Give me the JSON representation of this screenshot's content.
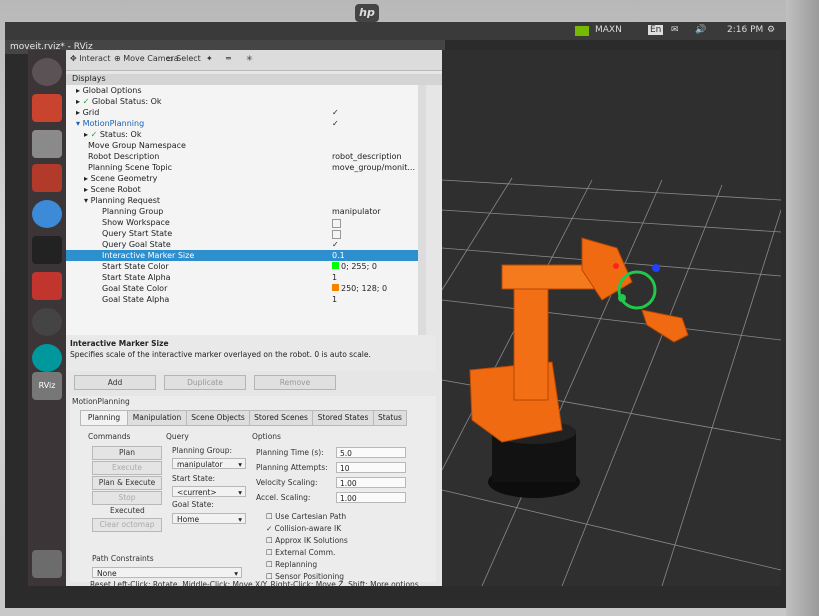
{
  "monitor": {
    "brand_logo": "hp"
  },
  "topbar": {
    "indicator": "MAXN",
    "keyboard": "En",
    "time": "2:16 PM"
  },
  "window": {
    "title": "moveit.rviz* - RViz"
  },
  "toolbar": {
    "interact": "Interact",
    "move_camera": "Move Camera",
    "select": "Select"
  },
  "displays": {
    "title": "Displays",
    "rows": [
      {
        "label": "Global Options",
        "value": ""
      },
      {
        "label": "Global Status: Ok",
        "value": ""
      },
      {
        "label": "Grid",
        "value": "✓"
      },
      {
        "label": "MotionPlanning",
        "value": "✓"
      },
      {
        "label": "Status: Ok",
        "value": ""
      },
      {
        "label": "Move Group Namespace",
        "value": ""
      },
      {
        "label": "Robot Description",
        "value": "robot_description"
      },
      {
        "label": "Planning Scene Topic",
        "value": "move_group/monit..."
      },
      {
        "label": "Scene Geometry",
        "value": ""
      },
      {
        "label": "Scene Robot",
        "value": ""
      },
      {
        "label": "Planning Request",
        "value": ""
      },
      {
        "label": "Planning Group",
        "value": "manipulator"
      },
      {
        "label": "Show Workspace",
        "value": ""
      },
      {
        "label": "Query Start State",
        "value": ""
      },
      {
        "label": "Query Goal State",
        "value": "✓"
      },
      {
        "label": "Interactive Marker Size",
        "value": "0.1"
      },
      {
        "label": "Start State Color",
        "value": "0; 255; 0"
      },
      {
        "label": "Start State Alpha",
        "value": "1"
      },
      {
        "label": "Goal State Color",
        "value": "250; 128; 0"
      },
      {
        "label": "Goal State Alpha",
        "value": "1"
      }
    ]
  },
  "description": {
    "title": "Interactive Marker Size",
    "text": "Specifies scale of the interactive marker overlayed on the robot. 0 is auto scale."
  },
  "display_buttons": {
    "add": "Add",
    "duplicate": "Duplicate",
    "remove": "Remove"
  },
  "motion_planning": {
    "title": "MotionPlanning",
    "tabs": [
      "Planning",
      "Manipulation",
      "Scene Objects",
      "Stored Scenes",
      "Stored States",
      "Status"
    ],
    "commands": {
      "title": "Commands",
      "plan": "Plan",
      "execute": "Execute",
      "plan_execute": "Plan & Execute",
      "stop": "Stop",
      "executed": "Executed",
      "clear_octomap": "Clear octomap"
    },
    "query": {
      "title": "Query",
      "planning_group_label": "Planning Group:",
      "planning_group": "manipulator",
      "start_state_label": "Start State:",
      "start_state": "<current>",
      "goal_state_label": "Goal State:",
      "goal_state": "Home"
    },
    "options": {
      "title": "Options",
      "planning_time_label": "Planning Time (s):",
      "planning_time": "5.0",
      "planning_attempts_label": "Planning Attempts:",
      "planning_attempts": "10",
      "velocity_scaling_label": "Velocity Scaling:",
      "velocity_scaling": "1.00",
      "accel_scaling_label": "Accel. Scaling:",
      "accel_scaling": "1.00",
      "checks": [
        "Use Cartesian Path",
        "Collision-aware IK",
        "Approx IK Solutions",
        "External Comm.",
        "Replanning",
        "Sensor Positioning"
      ]
    },
    "path_constraints_label": "Path Constraints",
    "path_constraints": "None"
  },
  "status": {
    "text": "Reset  Left-Click: Rotate. Middle-Click: Move X/Y. Right-Click: Move Z. Shift: More options."
  },
  "colors": {
    "selection": "#2e8fcf",
    "robot": "#f06a12",
    "robot_base": "#101010"
  }
}
